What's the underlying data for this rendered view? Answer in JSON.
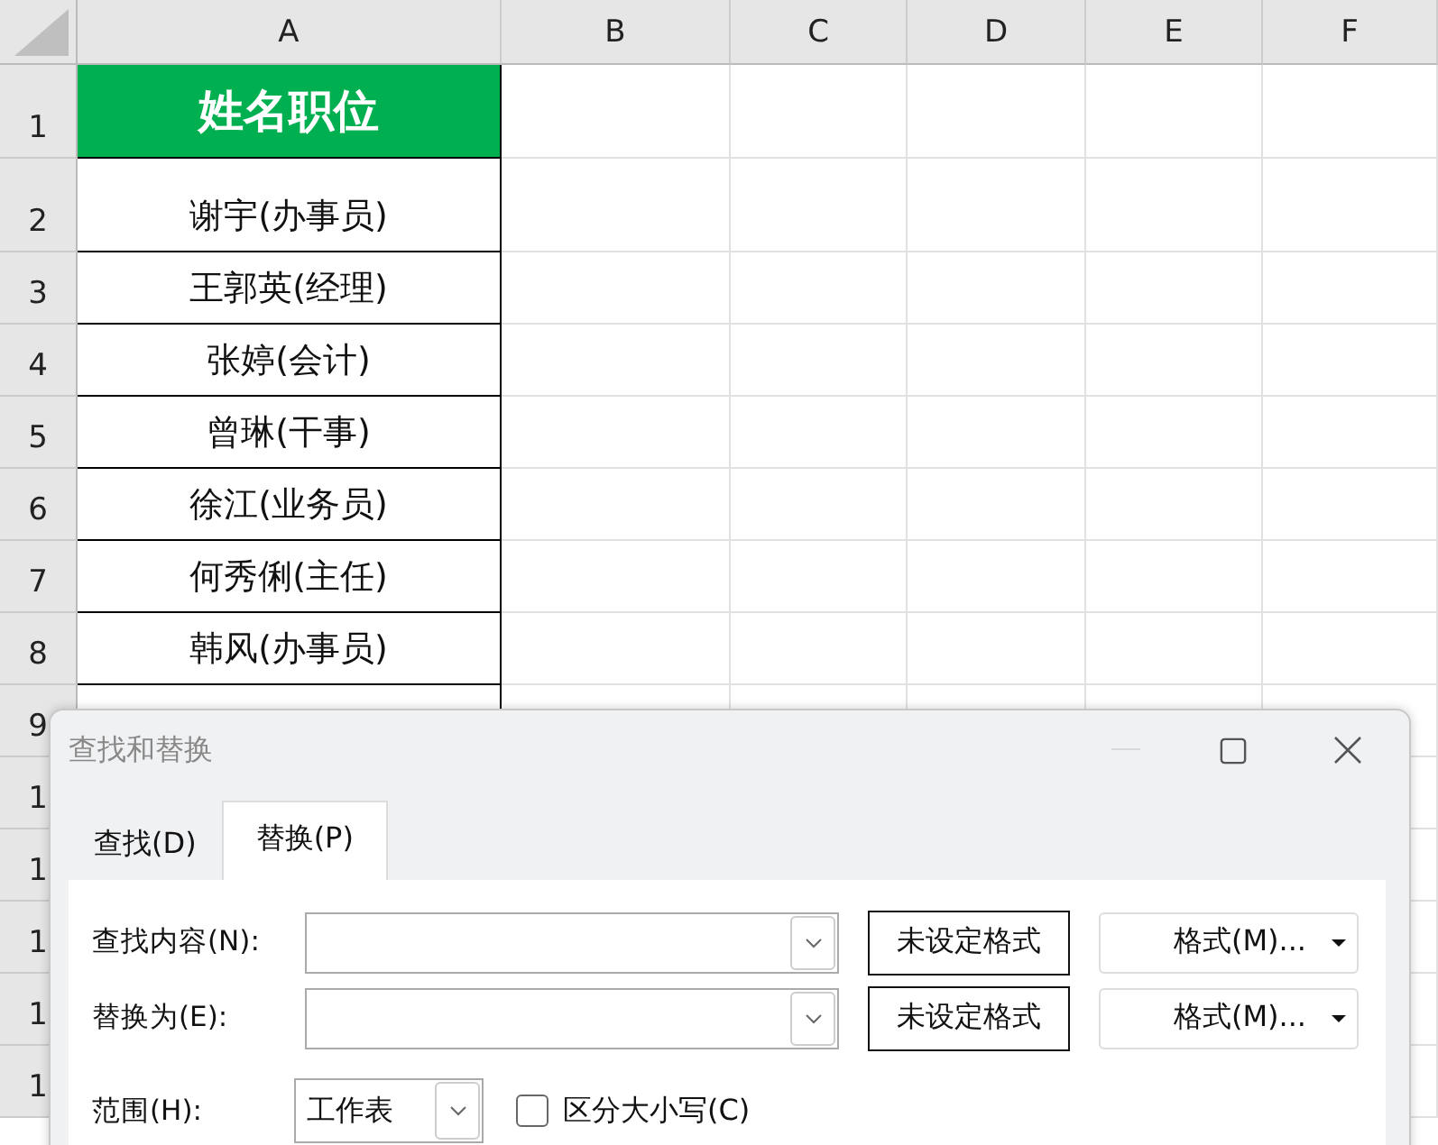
{
  "sheet": {
    "columns": [
      "A",
      "B",
      "C",
      "D",
      "E",
      "F"
    ],
    "rows": [
      {
        "number": "1",
        "cell": "姓名职位",
        "kind": "header"
      },
      {
        "number": "2",
        "cell": "谢宇(办事员)",
        "kind": "data"
      },
      {
        "number": "3",
        "cell": "王郭英(经理)",
        "kind": "data"
      },
      {
        "number": "4",
        "cell": "张婷(会计)",
        "kind": "data"
      },
      {
        "number": "5",
        "cell": "曾琳(干事)",
        "kind": "data"
      },
      {
        "number": "6",
        "cell": "徐江(业务员)",
        "kind": "data"
      },
      {
        "number": "7",
        "cell": "何秀俐(主任)",
        "kind": "data"
      },
      {
        "number": "8",
        "cell": "韩风(办事员)",
        "kind": "data"
      },
      {
        "number": "9",
        "kind": "data"
      },
      {
        "number": "1",
        "kind": "data"
      },
      {
        "number": "1",
        "kind": "data"
      },
      {
        "number": "1",
        "kind": "data"
      },
      {
        "number": "1",
        "kind": "data"
      },
      {
        "number": "1",
        "kind": "data"
      }
    ]
  },
  "dialog": {
    "title": "查找和替换",
    "tabs": [
      {
        "label": "查找(D)",
        "selected": false
      },
      {
        "label": "替换(P)",
        "selected": true
      }
    ],
    "fields": [
      {
        "label": "查找内容(N):",
        "format_status": "未设定格式",
        "format_button": "格式(M)..."
      },
      {
        "label": "替换为(E):",
        "format_status": "未设定格式",
        "format_button": "格式(M)..."
      }
    ],
    "range": {
      "label": "范围(H):",
      "value": "工作表"
    },
    "match_case": {
      "label": "区分大小写(C)",
      "checked": false
    }
  }
}
